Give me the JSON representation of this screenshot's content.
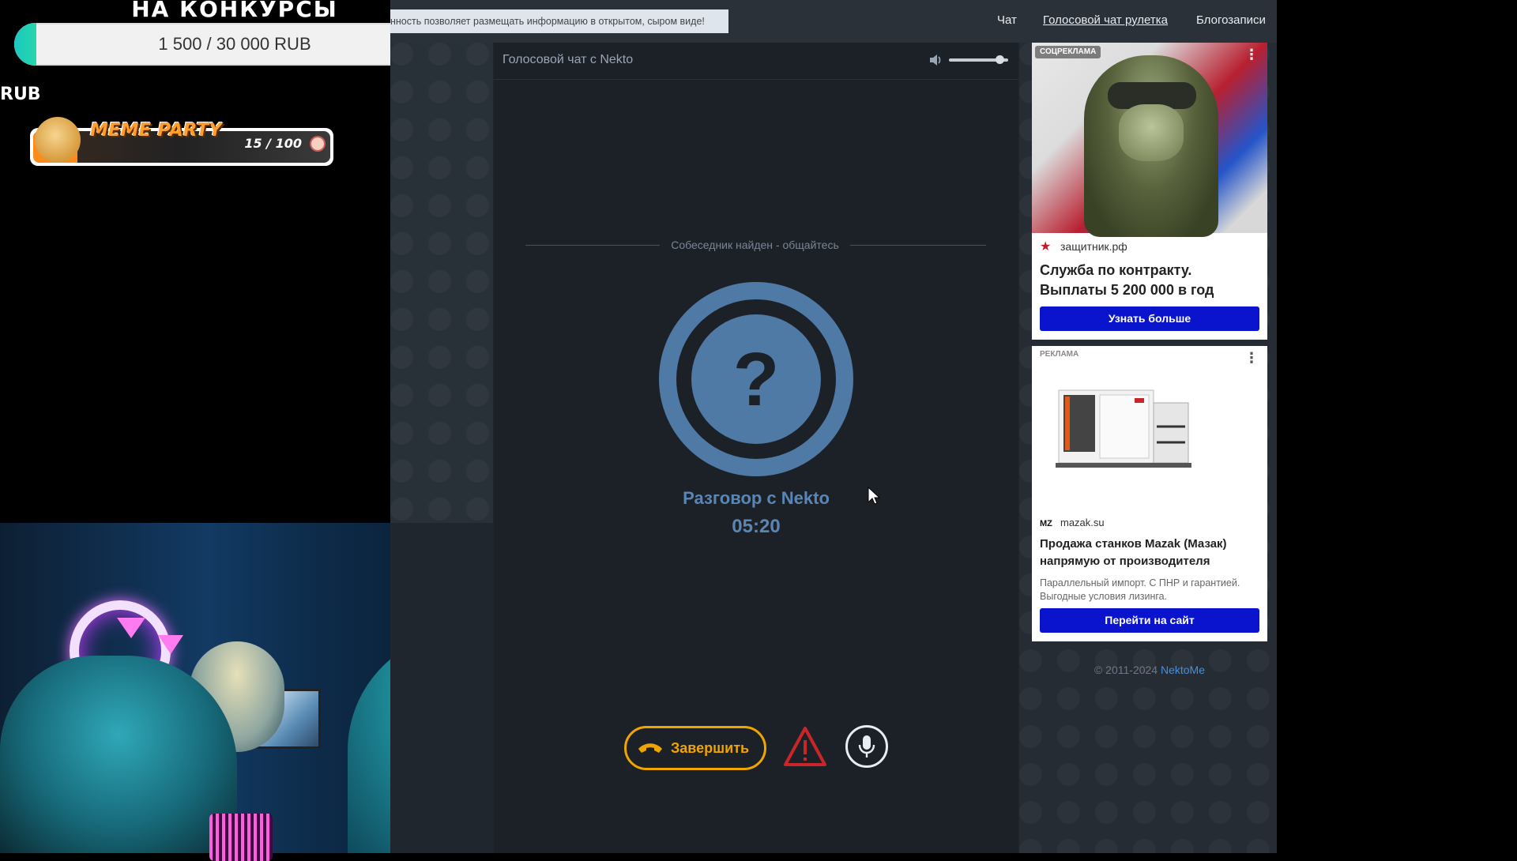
{
  "overlay": {
    "title": "НА КОНКУРСЫ",
    "donation_text": "1 500 / 30 000 RUB",
    "donation_progress": 0.05,
    "rub_fragment": "RUB",
    "meme_label": "MEME PARTY",
    "meme_count": "15 / 100",
    "meme_progress": 0.15
  },
  "site": {
    "notice": "нность позволяет размещать информацию в открытом, сыром виде!",
    "nav": [
      "Чат",
      "Голосовой чат рулетка",
      "Блогозаписи"
    ],
    "active_nav": "Голосовой чат рулетка",
    "chat_title": "Голосовой чат с Nekto",
    "found_status": "Собеседник найден - общайтесь",
    "talk_label": "Разговор с Nekto",
    "talk_timer": "05:20",
    "end_button": "Завершить",
    "icons": {
      "volume": "volume-icon",
      "phone": "phone-hangup-icon",
      "warning": "warning-icon",
      "mic": "microphone-icon"
    },
    "colors": {
      "accent_orange": "#f0a400",
      "avatar_blue": "#5b86b3",
      "ad_button": "#0a14cc"
    },
    "volume_level": 0.85
  },
  "ads": {
    "ad1": {
      "badge": "СОЦРЕКЛАМА",
      "source": "защитник.рф",
      "title": "Служба по контракту. Выплаты 5 200 000 в год",
      "button": "Узнать больше"
    },
    "ad2": {
      "badge": "РЕКЛАМА",
      "source_icon": "MZ",
      "source": "mazak.su",
      "title": "Продажа станков Mazak (Мазак) напрямую от производителя",
      "description": "Параллельный импорт. С ПНР и гарантией. Выгодные условия лизинга.",
      "button": "Перейти на сайт"
    }
  },
  "footer": {
    "copyright": "© 2011-2024",
    "brand_link": "NektoMe"
  }
}
